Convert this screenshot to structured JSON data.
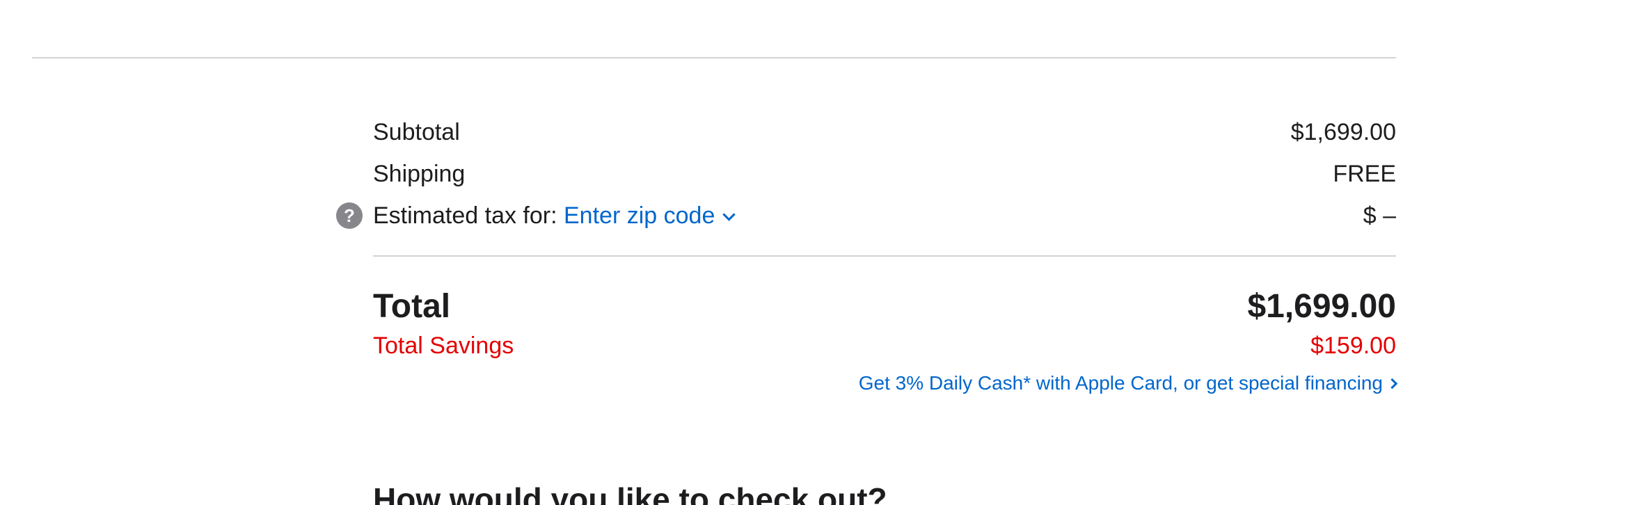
{
  "summary": {
    "subtotal": {
      "label": "Subtotal",
      "value": "$1,699.00"
    },
    "shipping": {
      "label": "Shipping",
      "value": "FREE"
    },
    "tax": {
      "help_icon": "?",
      "label": "Estimated tax for:",
      "zip_link": "Enter zip code",
      "value": "$ –"
    },
    "total": {
      "label": "Total",
      "value": "$1,699.00"
    },
    "savings": {
      "label": "Total Savings",
      "value": "$159.00"
    },
    "financing_link": "Get 3% Daily Cash* with Apple Card, or get special financing"
  },
  "checkout": {
    "heading": "How would you like to check out?"
  },
  "colors": {
    "text": "#1d1d1f",
    "link": "#0066cc",
    "savings": "#e30000",
    "divider": "#d2d2d7",
    "help_icon_bg": "#86868b"
  },
  "icons": {
    "help": "question-circle-icon",
    "zip_dropdown": "chevron-down-icon",
    "financing": "chevron-right-icon"
  }
}
